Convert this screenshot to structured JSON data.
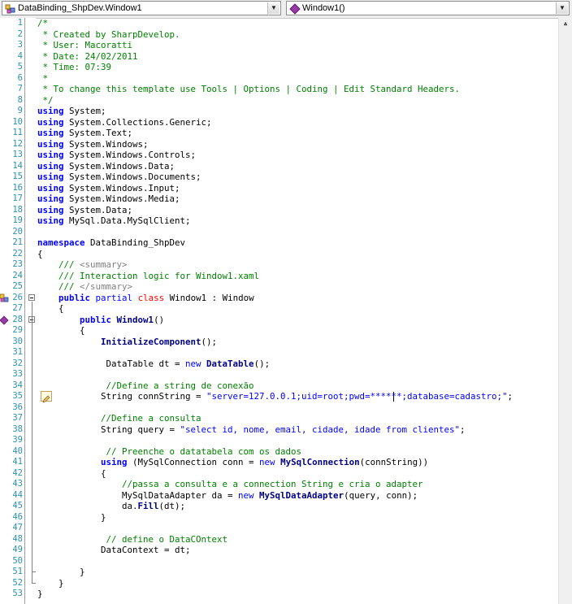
{
  "toolbar": {
    "class_combo": "DataBinding_ShpDev.Window1",
    "member_combo": "Window1()"
  },
  "colors": {
    "keyword": "#0000ff",
    "comment": "#008000",
    "line_number": "#2b91af",
    "class_keyword": "#ff0000"
  },
  "code_lines": [
    {
      "n": "1",
      "tokens": [
        [
          "cm",
          "/*"
        ]
      ]
    },
    {
      "n": "2",
      "tokens": [
        [
          "cm",
          " * Created by SharpDevelop."
        ]
      ]
    },
    {
      "n": "3",
      "tokens": [
        [
          "cm",
          " * User: Macoratti"
        ]
      ]
    },
    {
      "n": "4",
      "tokens": [
        [
          "cm",
          " * Date: 24/02/2011"
        ]
      ]
    },
    {
      "n": "5",
      "tokens": [
        [
          "cm",
          " * Time: 07:39"
        ]
      ]
    },
    {
      "n": "6",
      "tokens": [
        [
          "cm",
          " *"
        ]
      ]
    },
    {
      "n": "7",
      "tokens": [
        [
          "cm",
          " * To change this template use Tools | Options | Coding | Edit Standard Headers."
        ]
      ]
    },
    {
      "n": "8",
      "tokens": [
        [
          "cm",
          " */"
        ]
      ]
    },
    {
      "n": "9",
      "tokens": [
        [
          "kwb",
          "using"
        ],
        [
          "plain",
          " System;"
        ]
      ]
    },
    {
      "n": "10",
      "tokens": [
        [
          "kwb",
          "using"
        ],
        [
          "plain",
          " System.Collections.Generic;"
        ]
      ]
    },
    {
      "n": "11",
      "tokens": [
        [
          "kwb",
          "using"
        ],
        [
          "plain",
          " System.Text;"
        ]
      ]
    },
    {
      "n": "12",
      "tokens": [
        [
          "kwb",
          "using"
        ],
        [
          "plain",
          " System.Windows;"
        ]
      ]
    },
    {
      "n": "13",
      "tokens": [
        [
          "kwb",
          "using"
        ],
        [
          "plain",
          " System.Windows.Controls;"
        ]
      ]
    },
    {
      "n": "14",
      "tokens": [
        [
          "kwb",
          "using"
        ],
        [
          "plain",
          " System.Windows.Data;"
        ]
      ]
    },
    {
      "n": "15",
      "tokens": [
        [
          "kwb",
          "using"
        ],
        [
          "plain",
          " System.Windows.Documents;"
        ]
      ]
    },
    {
      "n": "16",
      "tokens": [
        [
          "kwb",
          "using"
        ],
        [
          "plain",
          " System.Windows.Input;"
        ]
      ]
    },
    {
      "n": "17",
      "tokens": [
        [
          "kwb",
          "using"
        ],
        [
          "plain",
          " System.Windows.Media;"
        ]
      ]
    },
    {
      "n": "18",
      "tokens": [
        [
          "kwb",
          "using"
        ],
        [
          "plain",
          " System.Data;"
        ]
      ]
    },
    {
      "n": "19",
      "tokens": [
        [
          "kwb",
          "using"
        ],
        [
          "plain",
          " MySql.Data.MySqlClient;"
        ]
      ]
    },
    {
      "n": "20",
      "tokens": []
    },
    {
      "n": "21",
      "tokens": [
        [
          "kwb",
          "namespace"
        ],
        [
          "plain",
          " DataBinding_ShpDev"
        ]
      ]
    },
    {
      "n": "22",
      "tokens": [
        [
          "plain",
          "{"
        ]
      ]
    },
    {
      "n": "23",
      "tokens": [
        [
          "cm",
          "    /// "
        ],
        [
          "cmgray",
          "<summary>"
        ]
      ]
    },
    {
      "n": "24",
      "tokens": [
        [
          "cm",
          "    /// Interaction logic for Window1.xaml"
        ]
      ]
    },
    {
      "n": "25",
      "tokens": [
        [
          "cm",
          "    /// "
        ],
        [
          "cmgray",
          "</summary>"
        ]
      ]
    },
    {
      "n": "26",
      "tokens": [
        [
          "plain",
          "    "
        ],
        [
          "kwb",
          "public"
        ],
        [
          "plain",
          " "
        ],
        [
          "kw",
          "partial"
        ],
        [
          "plain",
          " "
        ],
        [
          "cls",
          "class"
        ],
        [
          "plain",
          " Window1 : Window"
        ]
      ]
    },
    {
      "n": "27",
      "tokens": [
        [
          "plain",
          "    {"
        ]
      ]
    },
    {
      "n": "28",
      "tokens": [
        [
          "plain",
          "        "
        ],
        [
          "kwb",
          "public"
        ],
        [
          "plain",
          " "
        ],
        [
          "mb",
          "Window1"
        ],
        [
          "plain",
          "()"
        ]
      ]
    },
    {
      "n": "29",
      "tokens": [
        [
          "plain",
          "        {"
        ]
      ]
    },
    {
      "n": "30",
      "tokens": [
        [
          "plain",
          "            "
        ],
        [
          "mb",
          "InitializeComponent"
        ],
        [
          "plain",
          "();"
        ]
      ]
    },
    {
      "n": "31",
      "tokens": []
    },
    {
      "n": "32",
      "tokens": [
        [
          "plain",
          "             DataTable dt = "
        ],
        [
          "kw",
          "new"
        ],
        [
          "plain",
          " "
        ],
        [
          "mb",
          "DataTable"
        ],
        [
          "plain",
          "();"
        ]
      ]
    },
    {
      "n": "33",
      "tokens": []
    },
    {
      "n": "34",
      "tokens": [
        [
          "cm",
          "             //Define a string de conexão"
        ]
      ]
    },
    {
      "n": "35",
      "tokens": [
        [
          "plain",
          "            String connString = "
        ],
        [
          "str",
          "\"server=127.0.0.1;uid=root;pwd=******;database=cadastro;\""
        ],
        [
          "plain",
          ";"
        ]
      ]
    },
    {
      "n": "36",
      "tokens": []
    },
    {
      "n": "37",
      "tokens": [
        [
          "cm",
          "            //Define a consulta"
        ]
      ]
    },
    {
      "n": "38",
      "tokens": [
        [
          "plain",
          "            String query = "
        ],
        [
          "str",
          "\"select id, nome, email, cidade, idade from clientes\""
        ],
        [
          "plain",
          ";"
        ]
      ]
    },
    {
      "n": "39",
      "tokens": []
    },
    {
      "n": "40",
      "tokens": [
        [
          "cm",
          "             // Preenche o datatabela com os dados"
        ]
      ]
    },
    {
      "n": "41",
      "tokens": [
        [
          "plain",
          "            "
        ],
        [
          "kwb",
          "using"
        ],
        [
          "plain",
          " (MySqlConnection conn = "
        ],
        [
          "kw",
          "new"
        ],
        [
          "plain",
          " "
        ],
        [
          "mb",
          "MySqlConnection"
        ],
        [
          "plain",
          "(connString))"
        ]
      ]
    },
    {
      "n": "42",
      "tokens": [
        [
          "plain",
          "            {"
        ]
      ]
    },
    {
      "n": "43",
      "tokens": [
        [
          "cm",
          "                //passa a consulta e a connection String e cria o adapter"
        ]
      ]
    },
    {
      "n": "44",
      "tokens": [
        [
          "plain",
          "                MySqlDataAdapter da = "
        ],
        [
          "kw",
          "new"
        ],
        [
          "plain",
          " "
        ],
        [
          "mb",
          "MySqlDataAdapter"
        ],
        [
          "plain",
          "(query, conn);"
        ]
      ]
    },
    {
      "n": "45",
      "tokens": [
        [
          "plain",
          "                da."
        ],
        [
          "mb",
          "Fill"
        ],
        [
          "plain",
          "(dt);"
        ]
      ]
    },
    {
      "n": "46",
      "tokens": [
        [
          "plain",
          "            }"
        ]
      ]
    },
    {
      "n": "47",
      "tokens": []
    },
    {
      "n": "48",
      "tokens": [
        [
          "cm",
          "             // define o DataCOntext"
        ]
      ]
    },
    {
      "n": "49",
      "tokens": [
        [
          "plain",
          "            DataContext = dt;"
        ]
      ]
    },
    {
      "n": "50",
      "tokens": []
    },
    {
      "n": "51",
      "tokens": [
        [
          "plain",
          "        }"
        ]
      ]
    },
    {
      "n": "52",
      "tokens": [
        [
          "plain",
          "    }"
        ]
      ]
    },
    {
      "n": "53",
      "tokens": [
        [
          "plain",
          "}"
        ]
      ]
    }
  ]
}
